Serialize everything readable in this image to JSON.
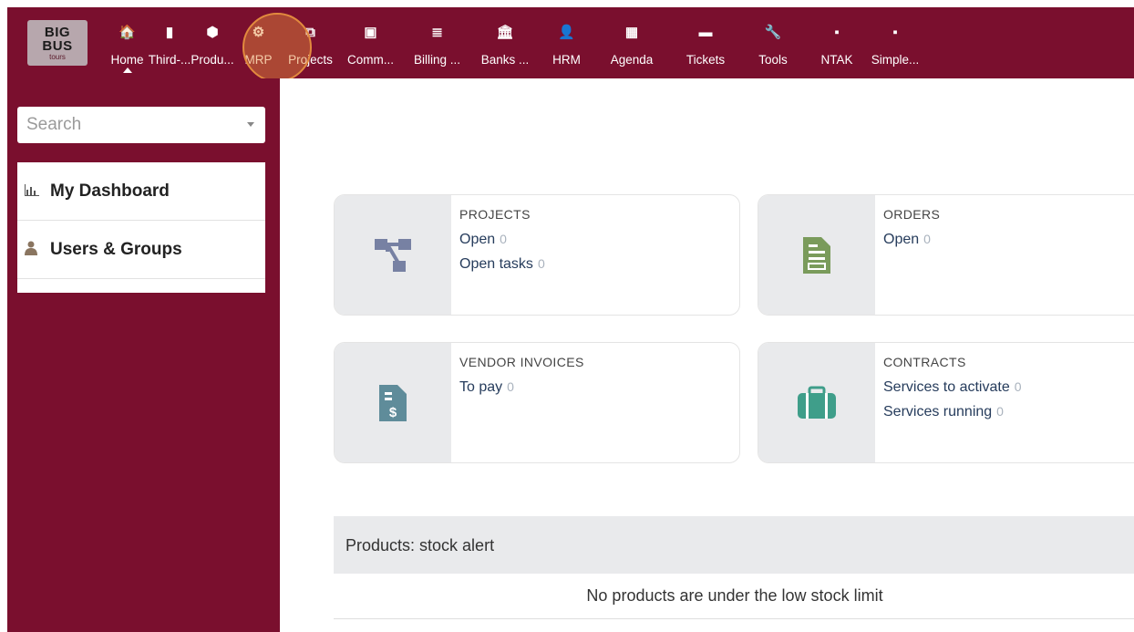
{
  "logo": {
    "line1": "BIG",
    "line2": "BUS",
    "line3": "tours"
  },
  "menu": [
    {
      "icon": "home-icon",
      "glyph": "🏠",
      "label": "Home",
      "width": 45
    },
    {
      "icon": "building-icon",
      "glyph": "▮",
      "label": "Third-...",
      "width": 48
    },
    {
      "icon": "cube-icon",
      "glyph": "⬢",
      "label": "Produ...",
      "width": 46
    },
    {
      "icon": "gears-icon",
      "glyph": "⚙",
      "label": "MRP",
      "width": 55
    },
    {
      "icon": "sitemap-icon",
      "glyph": "⧉",
      "label": "Projects",
      "width": 59
    },
    {
      "icon": "briefcase-icon",
      "glyph": "▣",
      "label": "Comm...",
      "width": 73
    },
    {
      "icon": "coins-icon",
      "glyph": "≣",
      "label": "Billing ...",
      "width": 73
    },
    {
      "icon": "bank-icon",
      "glyph": "🏛",
      "label": "Banks ...",
      "width": 76
    },
    {
      "icon": "user-icon",
      "glyph": "👤",
      "label": "HRM",
      "width": 59
    },
    {
      "icon": "calendar-icon",
      "glyph": "▦",
      "label": "Agenda",
      "width": 84
    },
    {
      "icon": "ticket-icon",
      "glyph": "▬",
      "label": "Tickets",
      "width": 78
    },
    {
      "icon": "wrench-icon",
      "glyph": "🔧",
      "label": "Tools",
      "width": 70
    },
    {
      "icon": "note-icon",
      "glyph": "▪",
      "label": "NTAK",
      "width": 70
    },
    {
      "icon": "note-icon",
      "glyph": "▪",
      "label": "Simple...",
      "width": 58
    }
  ],
  "sidebar": {
    "search_placeholder": "Search",
    "items": [
      {
        "icon": "chart-icon",
        "glyph": "📊",
        "label": "My Dashboard"
      },
      {
        "icon": "users-icon",
        "glyph": "👤",
        "label": "Users & Groups"
      }
    ]
  },
  "boxes": [
    {
      "title": "PROJECTS",
      "icon": "sitemap-icon",
      "color": "#7781a3",
      "rows": [
        {
          "label": "Open",
          "value": "0"
        },
        {
          "label": "Open tasks",
          "value": "0"
        }
      ]
    },
    {
      "title": "ORDERS",
      "icon": "order-doc-icon",
      "color": "#7a9b5b",
      "rows": [
        {
          "label": "Open",
          "value": "0"
        }
      ]
    },
    {
      "title": "VENDOR INVOICES",
      "icon": "invoice-dollar-icon",
      "color": "#5f8c9a",
      "rows": [
        {
          "label": "To pay",
          "value": "0"
        }
      ]
    },
    {
      "title": "CONTRACTS",
      "icon": "suitcase-icon",
      "color": "#3f9e8a",
      "rows": [
        {
          "label": "Services to activate",
          "value": "0"
        },
        {
          "label": "Services running",
          "value": "0"
        }
      ]
    }
  ],
  "stock_alert": {
    "title": "Products: stock alert",
    "message": "No products are under the low stock limit"
  },
  "colors": {
    "brand": "#7a0f2e",
    "highlight": "#e28a3e"
  }
}
